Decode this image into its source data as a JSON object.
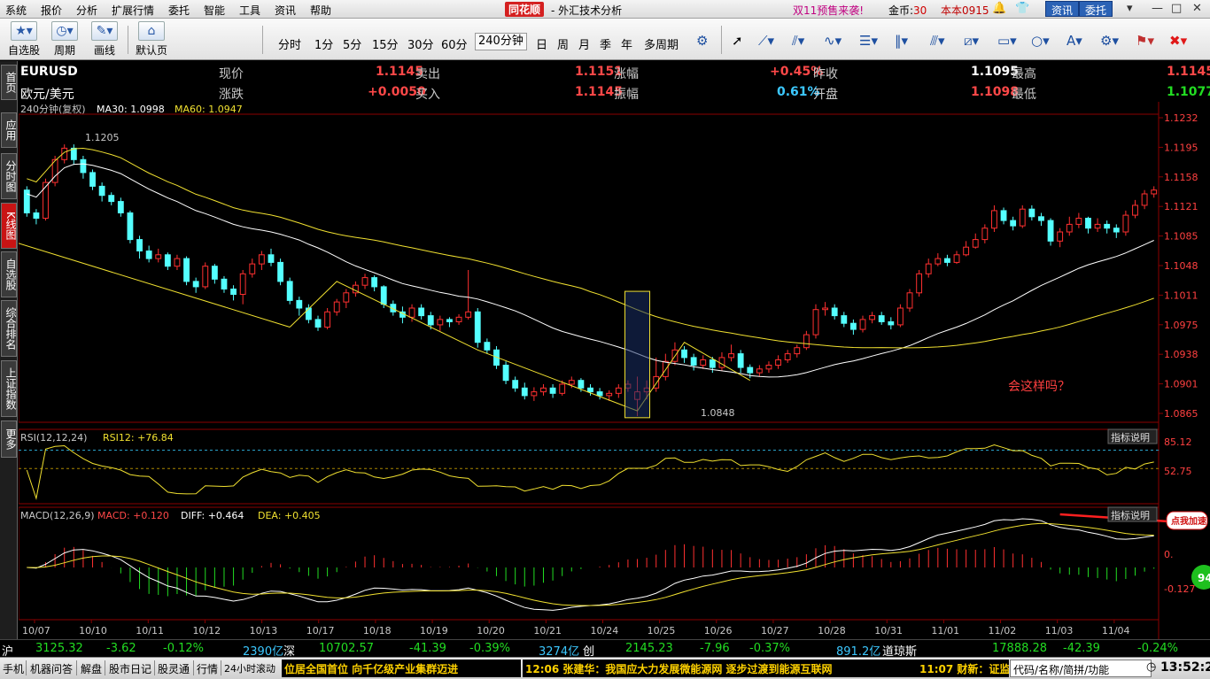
{
  "menu": {
    "items": [
      "系统",
      "报价",
      "分析",
      "扩展行情",
      "委托",
      "智能",
      "工具",
      "资讯",
      "帮助"
    ],
    "logo": "同花顺",
    "app_title": "- 外汇技术分析",
    "promo": "双11预售来袭!",
    "coins_label": "金币:",
    "coins_value": "30",
    "user": "本本0915",
    "btn_info": "资讯",
    "btn_trade": "委托"
  },
  "toolbar": {
    "tools": [
      {
        "label": "自选股",
        "icon": "star-icon"
      },
      {
        "label": "周期",
        "icon": "clock-icon"
      },
      {
        "label": "画线",
        "icon": "pencil-icon"
      },
      {
        "label": "默认页",
        "icon": "home-icon"
      }
    ],
    "periods": [
      "分时",
      "1分",
      "5分",
      "15分",
      "30分",
      "60分",
      "240分钟",
      "日",
      "周",
      "月",
      "季",
      "年",
      "多周期"
    ],
    "active_period": "240分钟"
  },
  "left_tabs": [
    "首页",
    "应用",
    "分时图",
    "K线图",
    "自选股",
    "综合排名",
    "上证指数",
    "更多"
  ],
  "quote": {
    "code": "EURUSD",
    "name": "欧元/美元",
    "rows": [
      [
        {
          "label": "现价",
          "value": "1.1145",
          "color": "red"
        },
        {
          "label": "卖出",
          "value": "1.1151",
          "color": "red"
        },
        {
          "label": "涨幅",
          "value": "+0.45%",
          "color": "red"
        },
        {
          "label": "昨收",
          "value": "1.1095",
          "color": "white"
        },
        {
          "label": "最高",
          "value": "1.1145",
          "color": "red"
        }
      ],
      [
        {
          "label": "涨跌",
          "value": "+0.0050",
          "color": "red"
        },
        {
          "label": "买入",
          "value": "1.1145",
          "color": "red"
        },
        {
          "label": "振幅",
          "value": "0.61%",
          "color": "blue"
        },
        {
          "label": "开盘",
          "value": "1.1098",
          "color": "red"
        },
        {
          "label": "最低",
          "value": "1.1077",
          "color": "green"
        }
      ]
    ]
  },
  "chart_data": {
    "type": "candlestick",
    "info_prefix": "240分钟(复权)",
    "ma30_label": "MA30: 1.0998",
    "ma60_label": "MA60: 1.0947",
    "price_ticks": [
      "1.1232",
      "1.1195",
      "1.1158",
      "1.1121",
      "1.1085",
      "1.1048",
      "1.1011",
      "1.0975",
      "1.0938",
      "1.0901",
      "1.0865"
    ],
    "x_labels": [
      "10/07",
      "10/10",
      "10/11",
      "10/12",
      "10/13",
      "10/17",
      "10/18",
      "10/19",
      "10/20",
      "10/21",
      "10/24",
      "10/25",
      "10/26",
      "10/27",
      "10/28",
      "10/31",
      "11/01",
      "11/02",
      "11/03",
      "11/04"
    ],
    "high_label": "1.1205",
    "low_label": "1.0848",
    "annotation": "会这样吗？",
    "ylim": [
      1.084,
      1.124
    ],
    "candles": [
      [
        1.1145,
        1.1115,
        1.115,
        1.111
      ],
      [
        1.1115,
        1.1108,
        1.112,
        1.11
      ],
      [
        1.1108,
        1.1155,
        1.116,
        1.1105
      ],
      [
        1.1155,
        1.1185,
        1.119,
        1.115
      ],
      [
        1.1185,
        1.12,
        1.1205,
        1.118
      ],
      [
        1.12,
        1.1185,
        1.1205,
        1.1178
      ],
      [
        1.1185,
        1.1168,
        1.119,
        1.116
      ],
      [
        1.1168,
        1.115,
        1.1172,
        1.1145
      ],
      [
        1.115,
        1.1138,
        1.1155,
        1.113
      ],
      [
        1.1138,
        1.113,
        1.1142,
        1.1125
      ],
      [
        1.113,
        1.1115,
        1.1135,
        1.111
      ],
      [
        1.1115,
        1.108,
        1.1118,
        1.1075
      ],
      [
        1.108,
        1.1065,
        1.1085,
        1.1055
      ],
      [
        1.1065,
        1.1055,
        1.1072,
        1.105
      ],
      [
        1.1055,
        1.106,
        1.1068,
        1.105
      ],
      [
        1.106,
        1.1045,
        1.1063,
        1.104
      ],
      [
        1.1045,
        1.1055,
        1.106,
        1.104
      ],
      [
        1.1055,
        1.1025,
        1.1058,
        1.102
      ],
      [
        1.1025,
        1.1018,
        1.103,
        1.101
      ],
      [
        1.1018,
        1.1045,
        1.105,
        1.1015
      ],
      [
        1.1045,
        1.1028,
        1.1048,
        1.1022
      ],
      [
        1.1028,
        1.1015,
        1.1032,
        1.101
      ],
      [
        1.1015,
        1.1008,
        1.102,
        1.1
      ],
      [
        1.1008,
        1.1035,
        1.104,
        1.0995
      ],
      [
        1.1035,
        1.1048,
        1.1055,
        1.103
      ],
      [
        1.1048,
        1.106,
        1.1065,
        1.104
      ],
      [
        1.106,
        1.105,
        1.1068,
        1.1045
      ],
      [
        1.105,
        1.1025,
        1.1055,
        1.102
      ],
      [
        1.1025,
        1.1,
        1.103,
        1.0995
      ],
      [
        1.1,
        1.099,
        1.1005,
        1.098
      ],
      [
        1.099,
        1.0975,
        1.0995,
        1.097
      ],
      [
        1.0975,
        1.0965,
        1.098,
        1.096
      ],
      [
        1.0965,
        1.0985,
        1.099,
        1.0962
      ],
      [
        1.0985,
        1.0998,
        1.1002,
        1.098
      ],
      [
        1.0998,
        1.101,
        1.1015,
        1.099
      ],
      [
        1.101,
        1.102,
        1.1025,
        1.1005
      ],
      [
        1.102,
        1.103,
        1.1035,
        1.1015
      ],
      [
        1.103,
        1.1018,
        1.1033,
        1.1012
      ],
      [
        1.1018,
        1.0995,
        1.102,
        1.099
      ],
      [
        1.0995,
        1.0985,
        1.1,
        1.098
      ],
      [
        1.0985,
        1.0978,
        1.0992,
        1.097
      ],
      [
        1.0978,
        1.099,
        1.0995,
        1.0972
      ],
      [
        1.099,
        1.098,
        1.0995,
        1.0975
      ],
      [
        1.098,
        1.0968,
        1.0985,
        1.0962
      ],
      [
        1.0968,
        1.0975,
        1.098,
        1.096
      ],
      [
        1.0975,
        1.0972,
        1.0978,
        1.0965
      ],
      [
        1.0972,
        1.0978,
        1.0982,
        1.0968
      ],
      [
        1.0978,
        1.0985,
        1.104,
        1.0975
      ],
      [
        1.0985,
        1.0945,
        1.099,
        1.0938
      ],
      [
        1.0945,
        1.0935,
        1.095,
        1.093
      ],
      [
        1.0935,
        1.0915,
        1.094,
        1.091
      ],
      [
        1.0915,
        1.0895,
        1.092,
        1.089
      ],
      [
        1.0895,
        1.0885,
        1.09,
        1.088
      ],
      [
        1.0885,
        1.0875,
        1.0892,
        1.087
      ],
      [
        1.0875,
        1.088,
        1.0886,
        1.0868
      ],
      [
        1.088,
        1.0885,
        1.089,
        1.0875
      ],
      [
        1.0885,
        1.0878,
        1.089,
        1.0872
      ],
      [
        1.0878,
        1.089,
        1.0895,
        1.0875
      ],
      [
        1.089,
        1.0895,
        1.09,
        1.0885
      ],
      [
        1.0895,
        1.0885,
        1.0898,
        1.088
      ],
      [
        1.0885,
        1.088,
        1.089,
        1.0875
      ],
      [
        1.088,
        1.0875,
        1.0885,
        1.087
      ],
      [
        1.0875,
        1.0878,
        1.0882,
        1.0868
      ],
      [
        1.0878,
        1.0885,
        1.089,
        1.0872
      ],
      [
        1.0885,
        1.089,
        1.0895,
        1.088
      ],
      [
        1.087,
        1.088,
        1.09,
        1.0848
      ],
      [
        1.088,
        1.0885,
        1.0895,
        1.087
      ],
      [
        1.0885,
        1.09,
        1.0925,
        1.088
      ],
      [
        1.09,
        1.092,
        1.093,
        1.0895
      ],
      [
        1.092,
        1.0935,
        1.0945,
        1.0915
      ],
      [
        1.0935,
        1.0925,
        1.094,
        1.0918
      ],
      [
        1.0925,
        1.0915,
        1.093,
        1.0908
      ],
      [
        1.0915,
        1.0922,
        1.0928,
        1.091
      ],
      [
        1.0922,
        1.0912,
        1.0926,
        1.0905
      ],
      [
        1.0912,
        1.0925,
        1.0932,
        1.0908
      ],
      [
        1.0925,
        1.093,
        1.0942,
        1.092
      ],
      [
        1.093,
        1.0912,
        1.0935,
        1.0905
      ],
      [
        1.0912,
        1.0905,
        1.0916,
        1.0898
      ],
      [
        1.0905,
        1.091,
        1.0915,
        1.09
      ],
      [
        1.091,
        1.0915,
        1.092,
        1.0905
      ],
      [
        1.0915,
        1.0922,
        1.0928,
        1.091
      ],
      [
        1.0922,
        1.093,
        1.0935,
        1.0918
      ],
      [
        1.093,
        1.0938,
        1.0942,
        1.0925
      ],
      [
        1.0938,
        1.0955,
        1.096,
        1.0935
      ],
      [
        1.0955,
        1.0988,
        1.0995,
        1.095
      ],
      [
        1.0988,
        1.099,
        1.0998,
        1.098
      ],
      [
        1.099,
        1.098,
        1.0995,
        1.0975
      ],
      [
        1.098,
        1.097,
        1.0985,
        1.0965
      ],
      [
        1.097,
        1.0962,
        1.0975,
        1.0955
      ],
      [
        1.0962,
        1.0975,
        1.098,
        1.0958
      ],
      [
        1.0975,
        1.098,
        1.0985,
        1.097
      ],
      [
        1.098,
        1.0972,
        1.0985,
        1.0968
      ],
      [
        1.0972,
        1.0968,
        1.0978,
        1.0962
      ],
      [
        1.0968,
        1.099,
        1.0995,
        1.0965
      ],
      [
        1.099,
        1.101,
        1.1015,
        1.0985
      ],
      [
        1.101,
        1.1035,
        1.104,
        1.1005
      ],
      [
        1.1035,
        1.1048,
        1.1055,
        1.103
      ],
      [
        1.1048,
        1.1055,
        1.1062,
        1.1045
      ],
      [
        1.1055,
        1.105,
        1.106,
        1.1045
      ],
      [
        1.105,
        1.106,
        1.1065,
        1.1048
      ],
      [
        1.106,
        1.107,
        1.1078,
        1.1058
      ],
      [
        1.107,
        1.108,
        1.1088,
        1.1068
      ],
      [
        1.108,
        1.1095,
        1.11,
        1.1075
      ],
      [
        1.1095,
        1.1118,
        1.1125,
        1.109
      ],
      [
        1.1118,
        1.1105,
        1.1122,
        1.11
      ],
      [
        1.1105,
        1.1098,
        1.111,
        1.1092
      ],
      [
        1.1098,
        1.112,
        1.1125,
        1.1095
      ],
      [
        1.112,
        1.111,
        1.1125,
        1.1105
      ],
      [
        1.111,
        1.1105,
        1.1115,
        1.1098
      ],
      [
        1.1105,
        1.1078,
        1.1108,
        1.1072
      ],
      [
        1.1078,
        1.109,
        1.1095,
        1.107
      ],
      [
        1.109,
        1.11,
        1.111,
        1.1085
      ],
      [
        1.11,
        1.1108,
        1.1115,
        1.1095
      ],
      [
        1.1108,
        1.1095,
        1.111,
        1.1088
      ],
      [
        1.1095,
        1.11,
        1.1108,
        1.109
      ],
      [
        1.11,
        1.1095,
        1.1105,
        1.1088
      ],
      [
        1.1095,
        1.109,
        1.11,
        1.1082
      ],
      [
        1.109,
        1.1112,
        1.1118,
        1.1085
      ],
      [
        1.1112,
        1.1125,
        1.1132,
        1.1108
      ],
      [
        1.1125,
        1.114,
        1.1145,
        1.112
      ],
      [
        1.114,
        1.1145,
        1.115,
        1.1135
      ]
    ],
    "rsi": {
      "label": "RSI(12,12,24)",
      "value_label": "RSI12: +76.84",
      "button": "指标说明",
      "ticks": [
        "85.12",
        "52.75"
      ]
    },
    "macd": {
      "label": "MACD(12,26,9)",
      "macd_label": "MACD: +0.120",
      "diff_label": "DIFF: +0.464",
      "dea_label": "DEA: +0.405",
      "button": "指标说明",
      "ticks": [
        "0.",
        "-0.127"
      ],
      "badge": "点我加速",
      "badge_num": "94"
    }
  },
  "market_bar": {
    "sh_label": "沪",
    "sh_value": "3125.32",
    "sh_change": "-3.62",
    "sh_pct": "-0.12%",
    "sh_amount": "2390亿",
    "sz_label": "深",
    "sz_value": "10702.57",
    "sz_change": "-41.39",
    "sz_pct": "-0.39%",
    "sz_amount": "3274亿",
    "cy_label": "创",
    "cy_value": "2145.23",
    "cy_change": "-7.96",
    "cy_pct": "-0.37%",
    "cy_amount": "891.2亿",
    "dj_label": "道琼斯",
    "dj_value": "17888.28",
    "dj_change": "-42.39",
    "dj_pct": "-0.24%"
  },
  "status_bar": {
    "tabs": [
      "手机",
      "机器问答",
      "解盘",
      "股市日记",
      "股灵通",
      "行情",
      "24小时滚动"
    ],
    "news1": "位居全国首位 向千亿级产业集群迈进",
    "news2": "12:06 张建华：我国应大力发展微能源网 逐步过渡到能源互联网",
    "news3": "11:07 财新：证监",
    "search_placeholder": "代码/名称/简拼/功能",
    "clock": "13:52:25"
  },
  "colors": {
    "up": "#ff3030",
    "down": "#54ffff",
    "ma30": "#ffffff",
    "ma60": "#f0e030",
    "grid": "#8b0000"
  }
}
